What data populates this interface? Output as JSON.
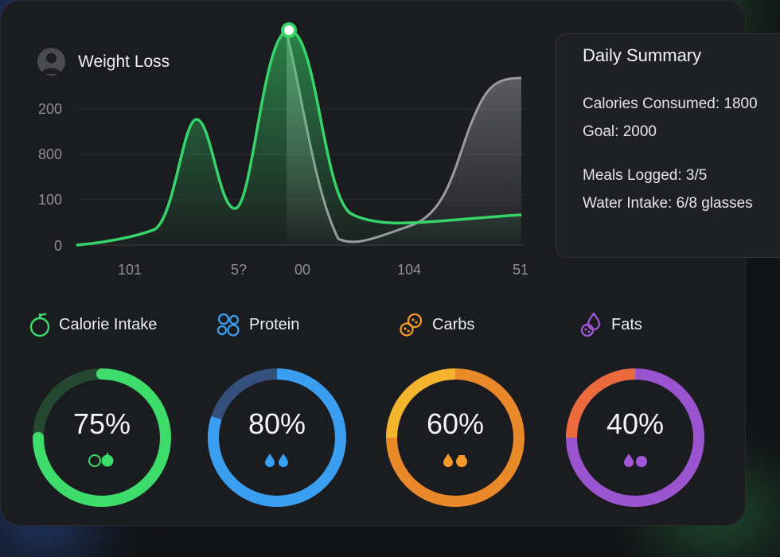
{
  "chart": {
    "title": "Weight Loss",
    "y_ticks": [
      "200",
      "800",
      "100",
      "0"
    ],
    "x_ticks": [
      "101",
      "5?",
      "00",
      "104",
      "51"
    ],
    "colors": {
      "primary": "#36d46a",
      "secondary": "#9a9b9f"
    }
  },
  "summary": {
    "heading": "Daily Summary",
    "calories": "Calories Consumed: 1800",
    "goal": "Goal: 2000",
    "meals": "Meals Logged: 3/5",
    "water": "Water Intake: 6/8 glasses"
  },
  "metrics": [
    {
      "label": "Calorie Intake",
      "value": "75%",
      "fraction": 0.75,
      "color": "#3ddc6b",
      "icon": "apple-icon"
    },
    {
      "label": "Protein",
      "value": "80%",
      "fraction": 0.8,
      "color": "#3a9ff0",
      "icon": "bubbles-icon"
    },
    {
      "label": "Carbs",
      "value": "60%",
      "fraction": 0.6,
      "color": "#f59a2a",
      "icon": "grains-icon"
    },
    {
      "label": "Fats",
      "value": "40%",
      "fraction": 0.4,
      "color": "#a259d9",
      "icon": "drops-icon"
    }
  ]
}
